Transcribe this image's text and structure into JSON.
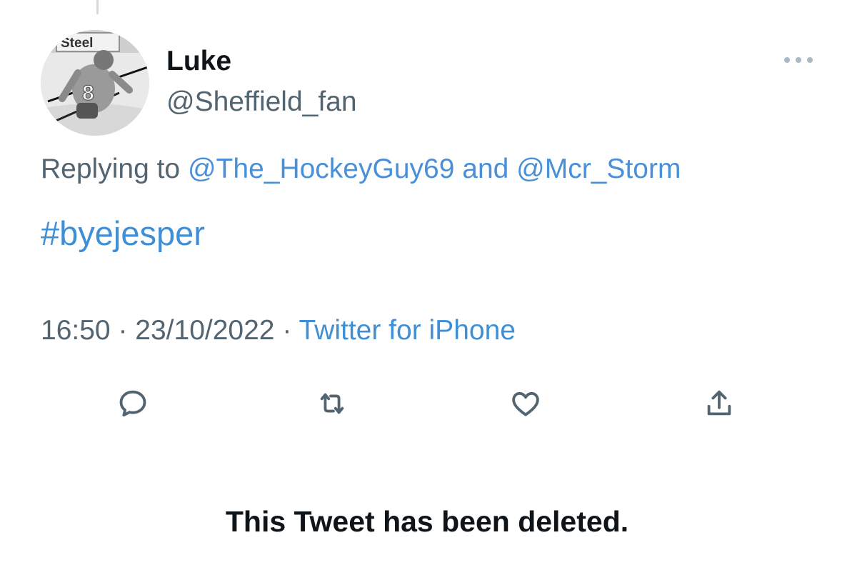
{
  "tweet": {
    "display_name": "Luke",
    "handle": "@Sheffield_fan",
    "avatar_icon": "avatar-hockey-player",
    "avatar_text": "Steel",
    "jersey_number": "8",
    "replying_prefix": "Replying to",
    "reply_to_1": "@The_HockeyGuy69",
    "reply_joiner": "and",
    "reply_to_2": "@Mcr_Storm",
    "hashtag": "#byejesper",
    "time": "16:50",
    "separator": "·",
    "date": "23/10/2022",
    "source": "Twitter for iPhone"
  },
  "actions": [
    {
      "icon": "reply-icon"
    },
    {
      "icon": "retweet-icon"
    },
    {
      "icon": "like-icon"
    },
    {
      "icon": "share-icon"
    }
  ],
  "deleted_notice": "This Tweet has been deleted.",
  "colors": {
    "link": "#1d9bf0",
    "muted": "#536471",
    "text": "#0f1419"
  }
}
